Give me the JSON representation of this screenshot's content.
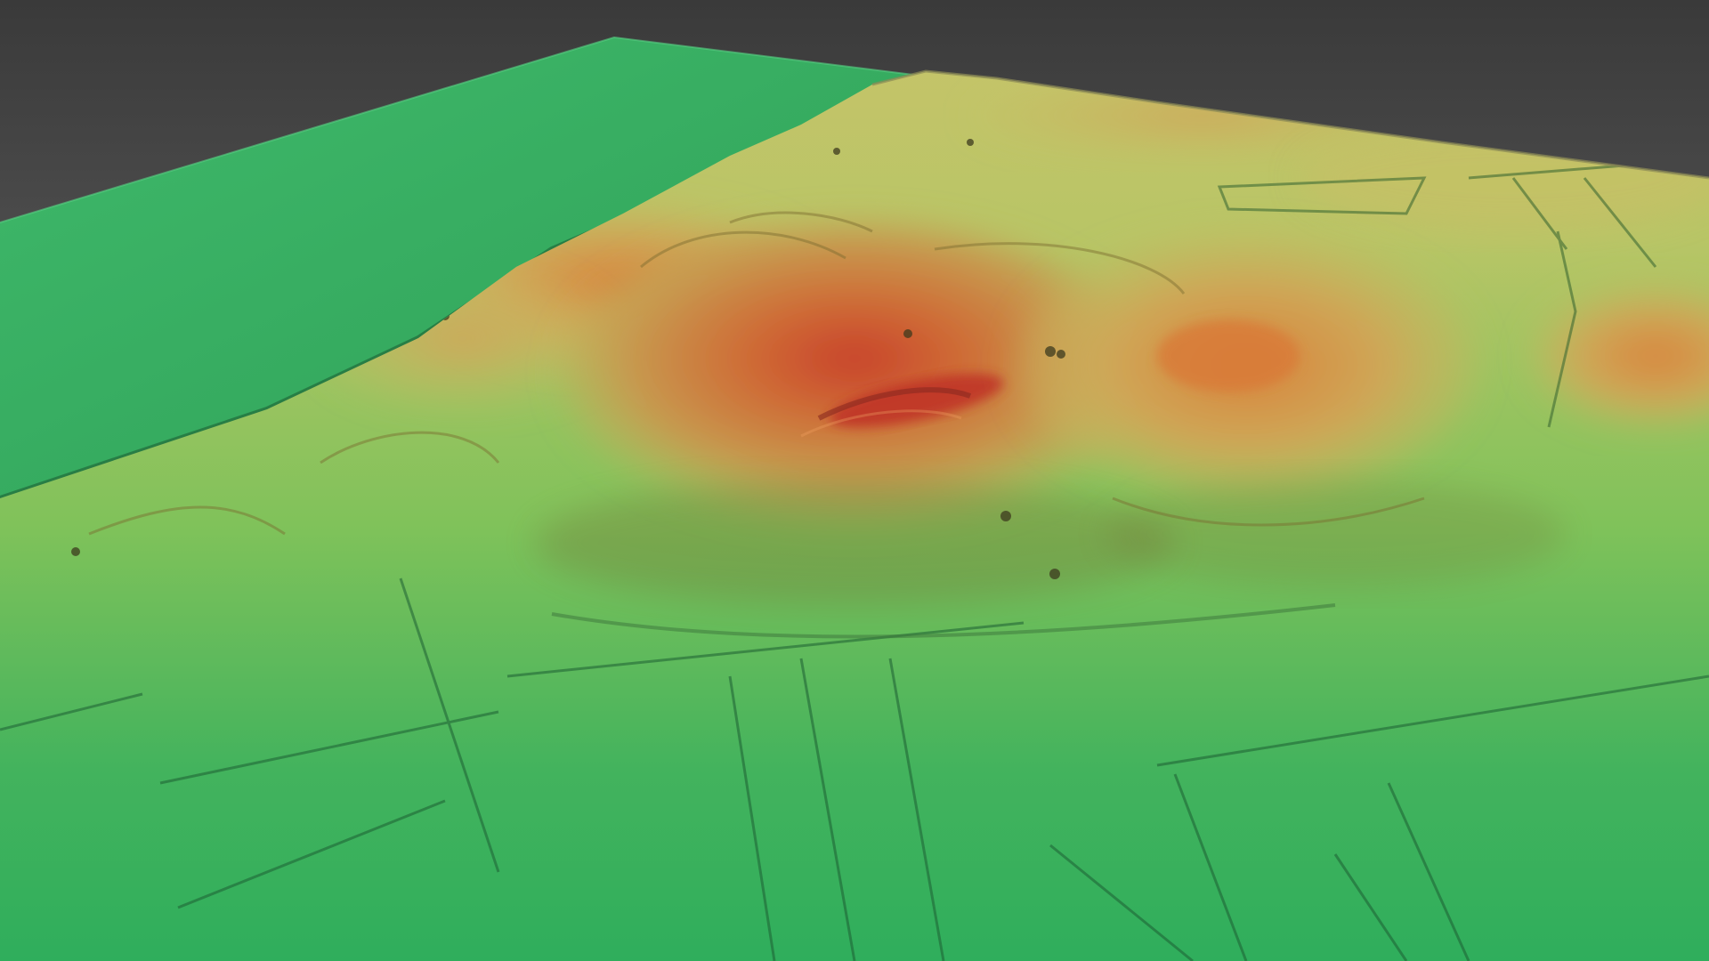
{
  "scene": {
    "kind": "3D terrain relief render (lidar elevation model)",
    "background_color": "#5b5b5b",
    "palette": {
      "low": "#2fae5c",
      "mid_low": "#7fc25a",
      "mid": "#c9c46a",
      "mid_high": "#d59a4a",
      "high": "#d0552d",
      "peak": "#b8342a"
    },
    "flat_plane_color": "#35ad62"
  }
}
